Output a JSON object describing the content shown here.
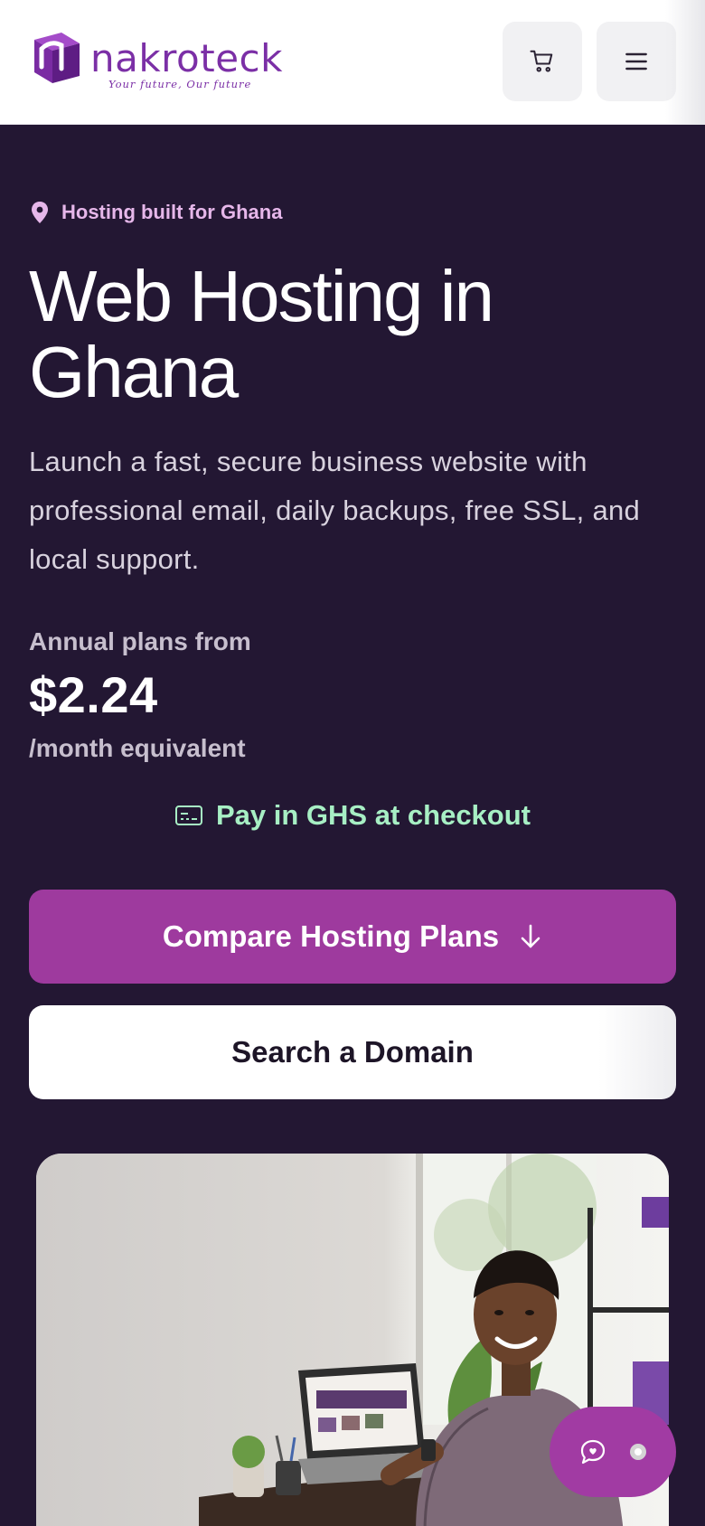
{
  "header": {
    "logo_text": "nakroteck",
    "logo_tagline": "Your future, Our future",
    "cart_icon": "cart-icon",
    "menu_icon": "hamburger-menu-icon"
  },
  "hero": {
    "eyebrow": "Hosting built for Ghana",
    "eyebrow_icon": "map-pin-icon",
    "title_line1": "Web Hosting in",
    "title_line2": "Ghana",
    "lead": "Launch a fast, secure business website with professional email, daily backups, free SSL, and local support.",
    "annual_label": "Annual plans from",
    "price": "$2.24",
    "per_month": "/month equivalent",
    "pay_note": "Pay in GHS at checkout",
    "pay_icon": "credit-card-icon",
    "primary_cta": "Compare Hosting Plans",
    "primary_cta_icon": "arrow-down-icon",
    "secondary_cta": "Search a Domain",
    "image_subject": "man-working-on-laptop"
  },
  "chat": {
    "icon": "chat-bubble-icon"
  },
  "colors": {
    "background": "#231733",
    "brand_purple": "#9e3a9e",
    "eyebrow_pink": "#e6b7ea",
    "accent_green": "#a7efc4"
  }
}
